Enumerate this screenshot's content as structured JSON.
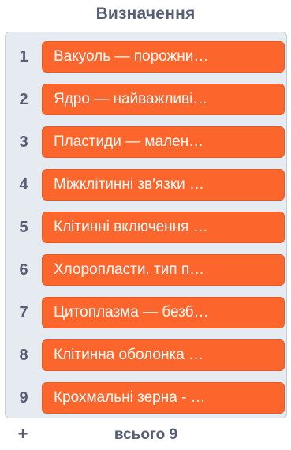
{
  "list": {
    "title": "Визначення",
    "items": [
      {
        "index": "1",
        "text": "Вакуоль — порожни…"
      },
      {
        "index": "2",
        "text": "Ядро — найважливі…"
      },
      {
        "index": "3",
        "text": "Пластиди — мален…"
      },
      {
        "index": "4",
        "text": "Міжклітинні зв'язки …"
      },
      {
        "index": "5",
        "text": "Клітинні включення …"
      },
      {
        "index": "6",
        "text": "Хлоропласти. тип п…"
      },
      {
        "index": "7",
        "text": "Цитоплазма — безб…"
      },
      {
        "index": "8",
        "text": "Клітинна оболонка …"
      },
      {
        "index": "9",
        "text": "Крохмальні зерна - …"
      }
    ],
    "add_label": "+",
    "count_label": "всього 9"
  },
  "colors": {
    "item_bg": "#fc662c",
    "list_bg": "#e6ebf2",
    "text_dark": "#575e75"
  }
}
